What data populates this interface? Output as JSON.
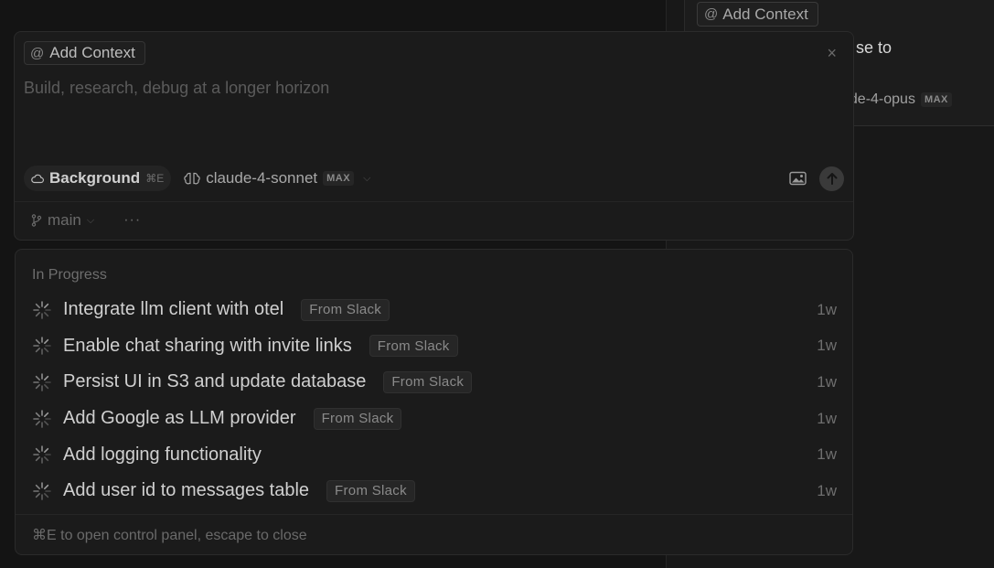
{
  "background": {
    "context_label": "Add Context",
    "fragment_text": "se to",
    "model_label": "ude-4-opus",
    "model_tag": "MAX"
  },
  "composer": {
    "context_label": "Add Context",
    "placeholder": "Build, research, debug at a longer horizon",
    "background_label": "Background",
    "background_shortcut": "⌘E",
    "model": "claude-4-sonnet",
    "model_tag": "MAX",
    "branch": "main",
    "more": "···"
  },
  "tasks": {
    "section_title": "In Progress",
    "items": [
      {
        "title": "Integrate llm client with otel",
        "badge": "From Slack",
        "age": "1w"
      },
      {
        "title": "Enable chat sharing with invite links",
        "badge": "From Slack",
        "age": "1w"
      },
      {
        "title": "Persist UI in S3 and update database",
        "badge": "From Slack",
        "age": "1w"
      },
      {
        "title": "Add Google as LLM provider",
        "badge": "From Slack",
        "age": "1w"
      },
      {
        "title": "Add logging functionality",
        "badge": "",
        "age": "1w"
      },
      {
        "title": "Add user id to messages table",
        "badge": "From Slack",
        "age": "1w"
      }
    ],
    "hint": "⌘E to open control panel, escape to close"
  },
  "icons": {
    "at": "at-icon",
    "close": "close-icon",
    "cloud": "cloud-icon",
    "brain": "brain-icon",
    "image": "image-icon",
    "send": "arrow-up-icon",
    "branch": "git-branch-icon",
    "chevron": "chevron-down-icon",
    "spinner": "spinner-icon"
  }
}
